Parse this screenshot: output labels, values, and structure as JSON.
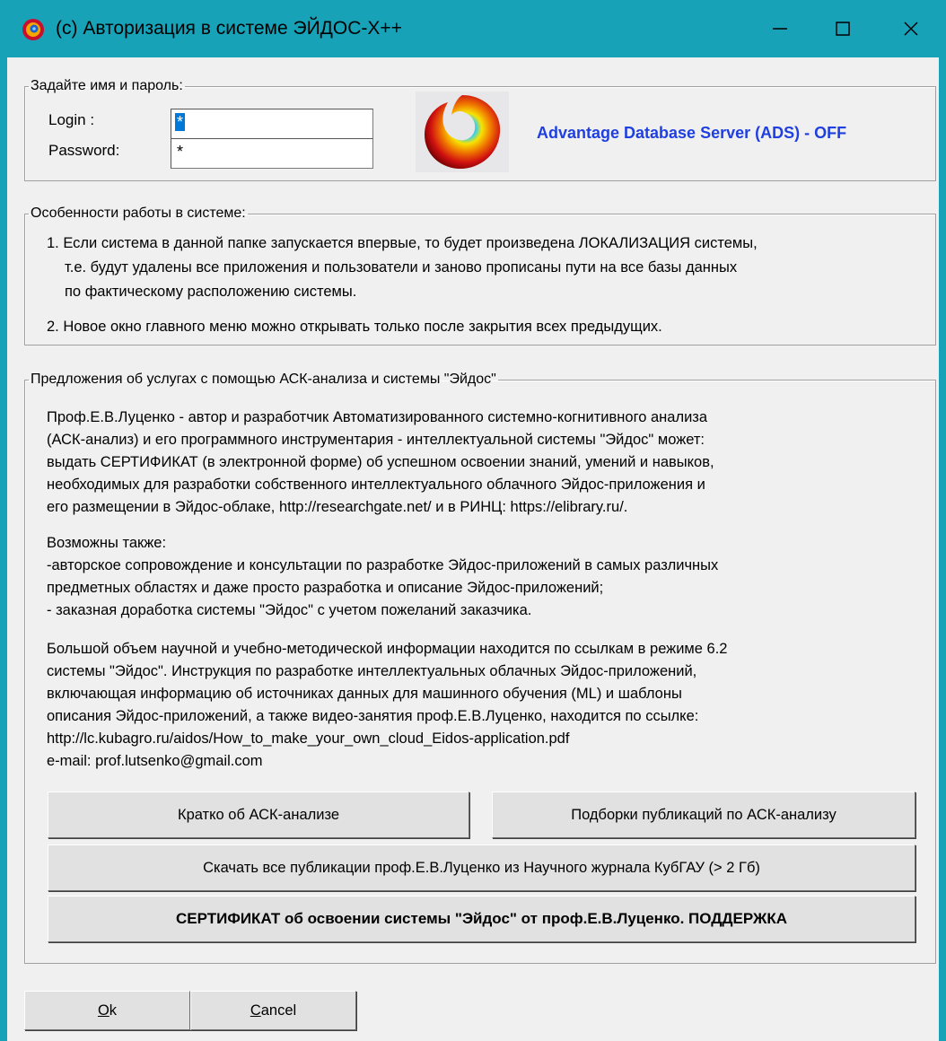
{
  "window": {
    "title": "(c) Авторизация в системе ЭЙДОС-X++",
    "app_icon": "eidos-logo-icon",
    "controls": [
      "minimize-icon",
      "maximize-icon",
      "close-icon"
    ],
    "accent": "#17a2b8"
  },
  "auth": {
    "legend": "Задайте имя и пароль:",
    "login_label": "Login  :",
    "login_value": "*",
    "password_label": "Password:",
    "password_value": "*",
    "ads_status": "Advantage Database Server (ADS) - OFF",
    "ads_color": "#1f3fe0"
  },
  "features": {
    "legend": "Особенности работы в системе:",
    "item1": [
      "1. Если система в данной папке запускается впервые, то будет произведена ЛОКАЛИЗАЦИЯ системы,",
      "т.е. будут удалены все приложения и пользователи и заново прописаны пути на все базы данных",
      "по фактическому расположению системы."
    ],
    "item2": "2. Новое окно главного меню можно открывать только после закрытия всех предыдущих."
  },
  "offers": {
    "legend": "Предложения об услугах с помощью АСК-анализа и системы \"Эйдос\"",
    "para1": [
      "Проф.Е.В.Луценко - автор и разработчик Автоматизированного системно-когнитивного анализа",
      "(АСК-анализ) и его программного инструментария - интеллектуальной системы \"Эйдос\" может:",
      "выдать СЕРТИФИКАТ (в электронной форме) об успешном освоении знаний, умений и навыков,",
      "необходимых для разработки собственного интеллектуального облачного Эйдос-приложения и",
      "его размещении в Эйдос-облаке, http://researchgate.net/ и в РИНЦ: https://elibrary.ru/."
    ],
    "para2": [
      "Возможны также:",
      "-авторское сопровождение и консультации по разработке Эйдос-приложений в самых различных",
      "предметных областях и даже просто разработка и описание Эйдос-приложений;",
      "- заказная доработка системы \"Эйдос\" с учетом пожеланий заказчика."
    ],
    "para3": [
      "Большой объем научной и учебно-методической информации находится по ссылкам в режиме 6.2",
      "системы \"Эйдос\". Инструкция по разработке интеллектуальных облачных Эйдос-приложений,",
      "включающая информацию об источниках данных для машинного обучения (ML) и шаблоны",
      "описания Эйдос-приложений, а также видео-занятия проф.Е.В.Луценко, находится по ссылке:",
      "http://lc.kubagro.ru/aidos/How_to_make_your_own_cloud_Eidos-application.pdf",
      "e-mail: prof.lutsenko@gmail.com"
    ],
    "btn_brief": "Кратко об АСК-анализе",
    "btn_collections": "Подборки публикаций по АСК-анализу",
    "btn_download": "Скачать все публикации проф.Е.В.Луценко из Научного журнала КубГАУ (> 2 Гб)",
    "btn_certificate": "СЕРТИФИКАТ об освоении системы \"Эйдос\" от проф.Е.В.Луценко. ПОДДЕРЖКА"
  },
  "footer": {
    "ok_accel": "O",
    "ok_rest": "k",
    "cancel_accel": "C",
    "cancel_rest": "ancel"
  }
}
